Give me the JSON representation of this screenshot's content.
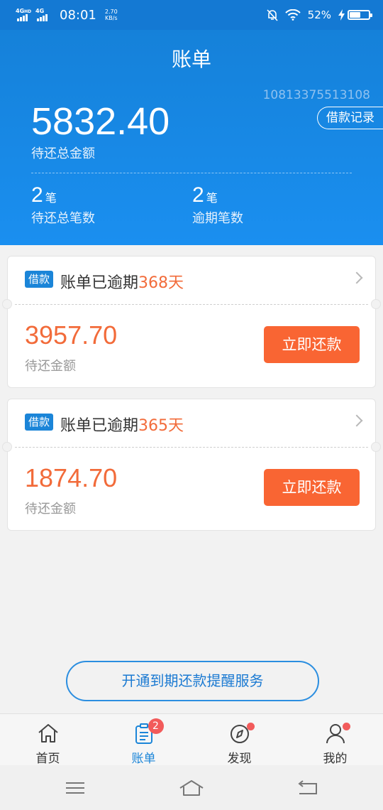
{
  "status_bar": {
    "network_1": "4G",
    "network_1_sup": "HD",
    "network_2": "4G",
    "time": "08:01",
    "speed_value": "2.70",
    "speed_unit": "KB/s",
    "battery_percent": "52%",
    "battery_level": 0.52,
    "icons": [
      "mute-bell-icon",
      "wifi-icon",
      "charging-bolt-icon",
      "battery-icon"
    ]
  },
  "header": {
    "title": "账单",
    "account": "10813375513108",
    "loan_record_button": "借款记录",
    "total_amount": "5832.40",
    "total_amount_label": "待还总金额",
    "pending_count": "2",
    "pending_unit": "笔",
    "pending_label": "待还总笔数",
    "overdue_count": "2",
    "overdue_unit": "笔",
    "overdue_label": "逾期笔数"
  },
  "bills": [
    {
      "tag": "借款",
      "status_prefix": "账单已逾期",
      "days": "368天",
      "amount": "3957.70",
      "amount_label": "待还金额",
      "pay_button": "立即还款"
    },
    {
      "tag": "借款",
      "status_prefix": "账单已逾期",
      "days": "365天",
      "amount": "1874.70",
      "amount_label": "待还金额",
      "pay_button": "立即还款"
    }
  ],
  "reminder_button": "开通到期还款提醒服务",
  "bottom_nav": {
    "items": [
      {
        "label": "首页",
        "icon": "home-icon"
      },
      {
        "label": "账单",
        "icon": "bill-icon",
        "badge": "2"
      },
      {
        "label": "发现",
        "icon": "compass-icon"
      },
      {
        "label": "我的",
        "icon": "user-icon"
      }
    ]
  },
  "system_nav": {
    "icons": [
      "menu-icon",
      "home-icon",
      "back-icon"
    ]
  },
  "colors": {
    "header_blue": "#1581d9",
    "accent_orange": "#f26b3a",
    "pay_button": "#f96533",
    "tag_blue": "#1b85d8",
    "badge_red": "#f25b5b"
  }
}
